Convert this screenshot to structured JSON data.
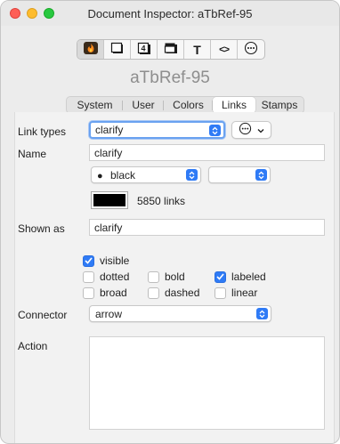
{
  "window": {
    "title": "Document Inspector: aTbRef-95"
  },
  "toolbar": {
    "icons": [
      "flame-icon",
      "note-icon",
      "calendar-icon",
      "stack-icon",
      "text-icon",
      "code-icon",
      "more-icon"
    ],
    "selected_index": 0,
    "text_glyph": "T",
    "code_glyph": "<>",
    "calendar_glyph": "4"
  },
  "document": {
    "name": "aTbRef-95"
  },
  "tabs": {
    "items": [
      {
        "label": "System"
      },
      {
        "label": "User"
      },
      {
        "label": "Colors"
      },
      {
        "label": "Links"
      },
      {
        "label": "Stamps"
      }
    ],
    "active_index": 3
  },
  "links": {
    "link_types_label": "Link types",
    "link_type_value": "clarify",
    "name_label": "Name",
    "name_value": "clarify",
    "color_value": "black",
    "color_bullet": "●",
    "secondary_popup_value": "",
    "swatch_color": "#000000",
    "link_count": "5850 links",
    "shown_as_label": "Shown as",
    "shown_as_value": "clarify",
    "options": [
      {
        "label": "visible",
        "checked": true
      },
      {
        "label": "dotted",
        "checked": false
      },
      {
        "label": "bold",
        "checked": false
      },
      {
        "label": "labeled",
        "checked": true
      },
      {
        "label": "broad",
        "checked": false
      },
      {
        "label": "dashed",
        "checked": false
      },
      {
        "label": "linear",
        "checked": false
      }
    ],
    "connector_label": "Connector",
    "connector_value": "arrow",
    "action_label": "Action",
    "action_value": ""
  },
  "colors": {
    "accent": "#2f7bf6",
    "focus_ring": "#6aa2f0",
    "close": "#fe5f57",
    "minimize": "#febc2e",
    "maximize": "#28c840"
  }
}
